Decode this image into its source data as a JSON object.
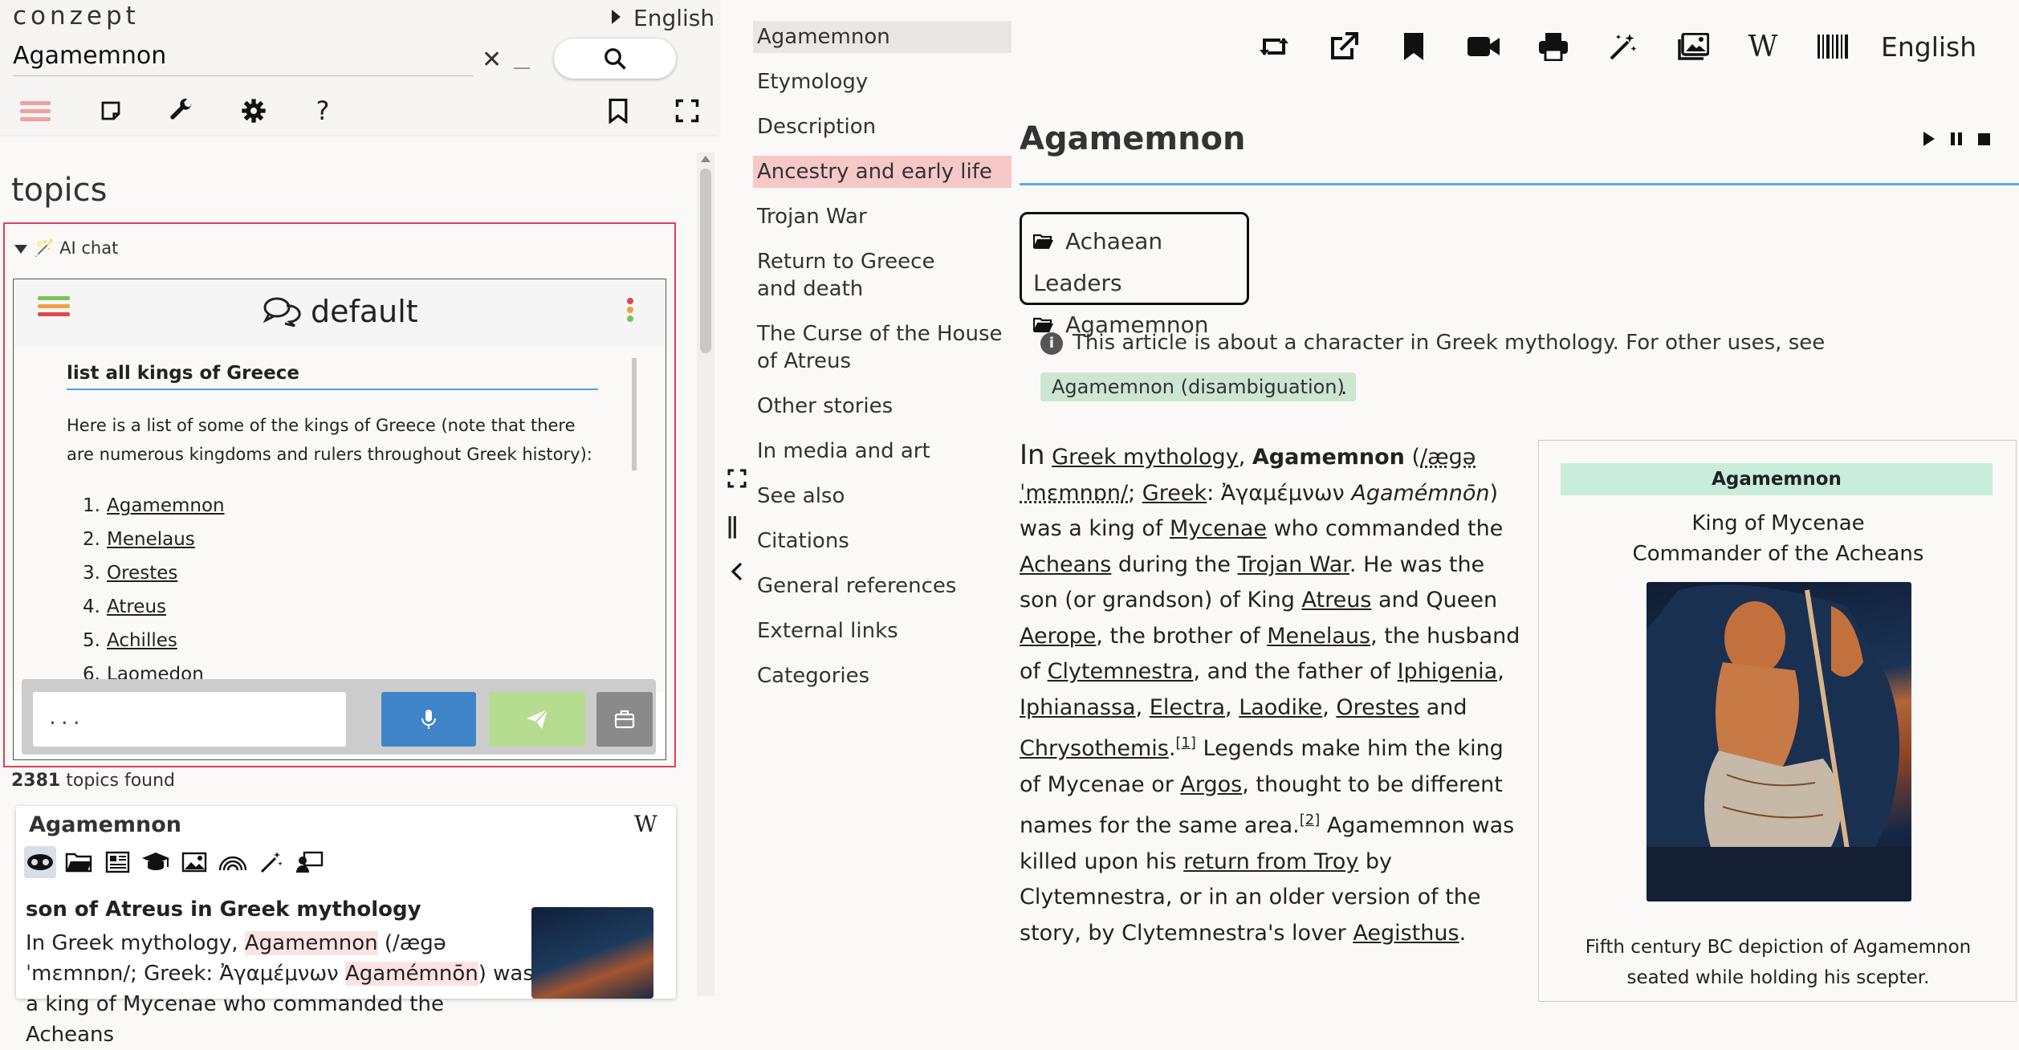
{
  "app": {
    "brand": "conzept",
    "language": "English"
  },
  "search": {
    "value": "Agamemnon"
  },
  "sidebar": {
    "topics_heading": "topics",
    "ai_chat_label": "AI chat",
    "chat": {
      "title": "default",
      "question": "list all kings of Greece",
      "answer_pre": "Here is a list of some of the kings of",
      "answer_link1": "Greece",
      "answer_mid": "(note that there are numerous kingdoms and rulers throughout",
      "answer_link2": "Greek",
      "answer_post": "history):",
      "kings": [
        "Agamemnon",
        "Menelaus",
        "Orestes",
        "Atreus",
        "Achilles",
        "Laomedon"
      ],
      "input_placeholder": "..."
    },
    "found_count": "2381",
    "found_label": "topics found",
    "card": {
      "title": "Agamemnon",
      "subtitle": "son of Atreus in Greek mythology",
      "text_a": "In Greek mythology,",
      "text_hl1": "Agamemnon",
      "text_b": "(/æɡə ˈmɛmnɒn/; Greek: Ἀγαμέμνων",
      "text_hl2": "Agamémnōn",
      "text_c": ") was a king of Mycenae who commanded the Acheans"
    }
  },
  "toc": {
    "items": [
      "Agamemnon",
      "Etymology",
      "Description",
      "Ancestry and early life",
      "Trojan War",
      "Return to Greece and death",
      "The Curse of the House of Atreus",
      "Other stories",
      "In media and art",
      "See also",
      "Citations",
      "General references",
      "External links",
      "Categories"
    ]
  },
  "article": {
    "title": "Agamemnon",
    "folders": [
      "Achaean Leaders",
      "Agamemnon"
    ],
    "note": "This article is about a character in Greek mythology. For other uses, see",
    "disambiguation": "Agamemnon (disambiguation)",
    "p": {
      "s1": "In",
      "l1": "Greek mythology",
      "s2": ",",
      "b1": "Agamemnon",
      "s3": "(",
      "l2": "/æɡə ˈmɛmnɒn/",
      "s4": ";",
      "l3": "Greek",
      "s5": ": Ἀγαμέμνων",
      "i1": "Agamémnōn",
      "s6": ") was a king of",
      "l4": "Mycenae",
      "s7": "who commanded the",
      "l5": "Acheans",
      "s8": "during the",
      "l6": "Trojan War",
      "s9": ". He was the son (or grandson) of King",
      "l7": "Atreus",
      "s10": "and Queen",
      "l8": "Aerope",
      "s11": ", the brother of",
      "l9": "Menelaus",
      "s12": ", the husband of",
      "l10": "Clytemnestra",
      "s13": ", and the father of",
      "l11": "Iphigenia",
      "l12": "Iphianassa",
      "l13": "Electra",
      "l14": "Laodike",
      "l15": "Orestes",
      "s14": "and",
      "l16": "Chrysothemis",
      "r1": "[1]",
      "s15": "Legends make him the king of Mycenae or",
      "l17": "Argos",
      "s16": ", thought to be different names for the same area.",
      "r2": "[2]",
      "s17": "Agamemnon was killed upon his",
      "l18": "return from Troy",
      "s18": "by Clytemnestra, or in an older version of the story, by Clytemnestra's lover",
      "l19": "Aegisthus",
      "s19": "."
    },
    "infobox": {
      "title": "Agamemnon",
      "subtitle1": "King of Mycenae",
      "subtitle2": "Commander of the Acheans",
      "caption": "Fifth century BC depiction of Agamemnon seated while holding his scepter."
    }
  },
  "toolbar": {
    "wiki_glyph": "W",
    "language": "English"
  },
  "colors": {
    "accent": "#4aa3df",
    "highlight": "#f6c8c8",
    "alert_border": "#e0405a",
    "note_green": "#cde6d2",
    "mic": "#3f84c6",
    "send": "#b5dc8f"
  }
}
